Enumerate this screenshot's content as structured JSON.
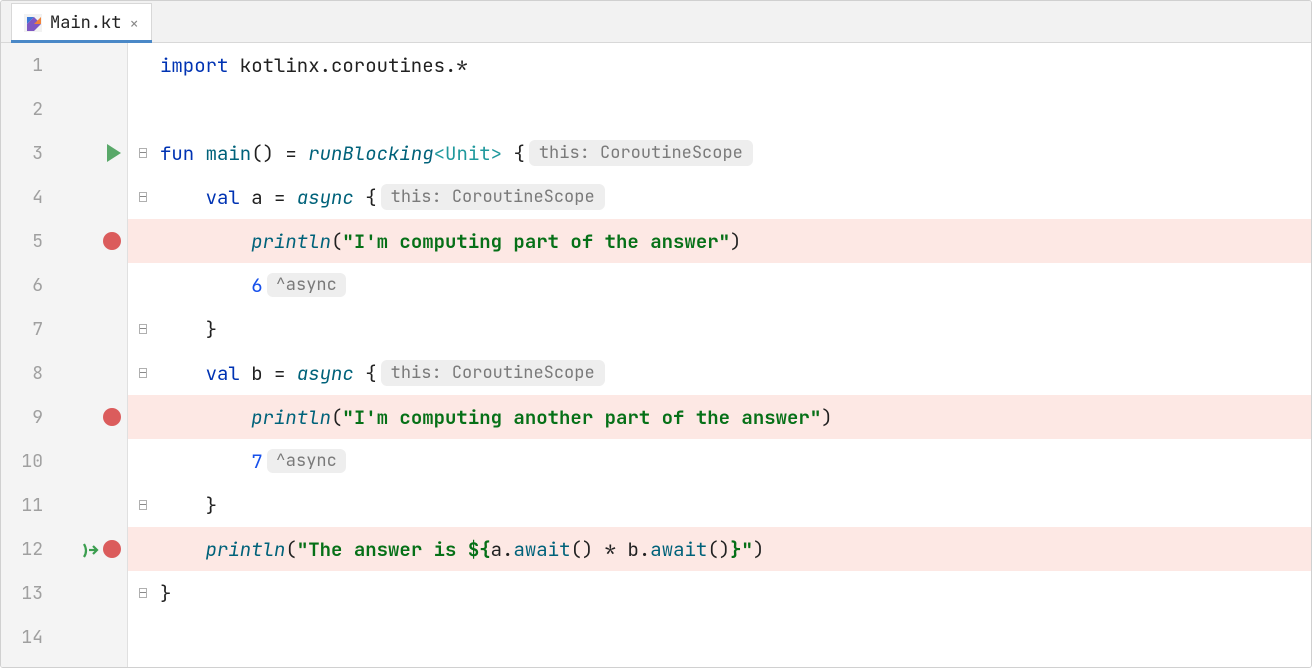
{
  "tab": {
    "filename": "Main.kt",
    "active": true
  },
  "lines": [
    {
      "n": 1
    },
    {
      "n": 2
    },
    {
      "n": 3,
      "run": true
    },
    {
      "n": 4
    },
    {
      "n": 5,
      "bp": true
    },
    {
      "n": 6
    },
    {
      "n": 7
    },
    {
      "n": 8
    },
    {
      "n": 9,
      "bp": true
    },
    {
      "n": 10
    },
    {
      "n": 11
    },
    {
      "n": 12,
      "bp": true,
      "suspend": true
    },
    {
      "n": 13
    },
    {
      "n": 14
    }
  ],
  "code": {
    "l1": {
      "kw": "import",
      "rest": " kotlinx.coroutines.*"
    },
    "l3": {
      "kw1": "fun",
      "name": " main",
      "parens": "() = ",
      "fn": "runBlocking",
      "gen": "<Unit>",
      "brace": " {",
      "hint": "this: CoroutineScope"
    },
    "l4": {
      "indent": "    ",
      "kw": "val",
      "name": " a = ",
      "fn": "async",
      "brace": " {",
      "hint": "this: CoroutineScope"
    },
    "l5": {
      "indent": "        ",
      "fn": "println",
      "open": "(",
      "str": "\"I'm computing part of the answer\"",
      "close": ")"
    },
    "l6": {
      "indent": "        ",
      "num": "6",
      "hint": "^async"
    },
    "l7": {
      "indent": "    ",
      "text": "}"
    },
    "l8": {
      "indent": "    ",
      "kw": "val",
      "name": " b = ",
      "fn": "async",
      "brace": " {",
      "hint": "this: CoroutineScope"
    },
    "l9": {
      "indent": "        ",
      "fn": "println",
      "open": "(",
      "str": "\"I'm computing another part of the answer\"",
      "close": ")"
    },
    "l10": {
      "indent": "        ",
      "num": "7",
      "hint": "^async"
    },
    "l11": {
      "indent": "    ",
      "text": "}"
    },
    "l12": {
      "indent": "    ",
      "fn": "println",
      "open": "(",
      "str1": "\"The answer is ",
      "tpl_open": "${",
      "expr1": "a.",
      "call1": "await",
      "mid": "() * b.",
      "call2": "await",
      "expr2": "()",
      "tpl_close": "}",
      "str2": "\"",
      "close": ")"
    },
    "l13": {
      "text": "}"
    }
  }
}
